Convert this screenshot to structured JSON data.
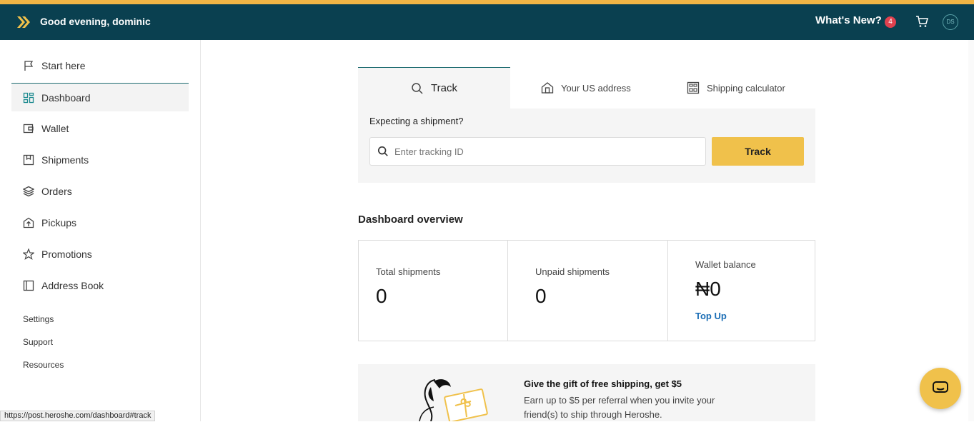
{
  "header": {
    "greeting": "Good evening, dominic",
    "whats_new": "What's New?",
    "whats_new_count": "4",
    "avatar_initials": "DS"
  },
  "sidebar": {
    "items": [
      {
        "label": "Start here",
        "icon": "flag-icon"
      },
      {
        "label": "Dashboard",
        "icon": "dashboard-icon"
      },
      {
        "label": "Wallet",
        "icon": "wallet-icon"
      },
      {
        "label": "Shipments",
        "icon": "box-icon"
      },
      {
        "label": "Orders",
        "icon": "layers-icon"
      },
      {
        "label": "Pickups",
        "icon": "pickup-icon"
      },
      {
        "label": "Promotions",
        "icon": "star-icon"
      },
      {
        "label": "Address Book",
        "icon": "book-icon"
      }
    ],
    "links": [
      "Settings",
      "Support",
      "Resources"
    ]
  },
  "tabs": {
    "track": "Track",
    "us_address": "Your US address",
    "calculator": "Shipping calculator"
  },
  "track_panel": {
    "prompt": "Expecting a shipment?",
    "placeholder": "Enter tracking ID",
    "button": "Track"
  },
  "overview": {
    "title": "Dashboard overview",
    "total_label": "Total shipments",
    "total_value": "0",
    "unpaid_label": "Unpaid shipments",
    "unpaid_value": "0",
    "wallet_label": "Wallet balance",
    "wallet_value": "₦0",
    "topup": "Top Up"
  },
  "promo": {
    "title": "Give the gift of free shipping, get $5",
    "text": "Earn up to $5 per referral when you invite your friend(s) to ship through Heroshe."
  },
  "status_url": "https://post.heroshe.com/dashboard#track",
  "colors": {
    "header_bg": "#0a4050",
    "accent_yellow": "#f0c14b",
    "link_blue": "#1a6db5",
    "badge_red": "#e0414f"
  }
}
